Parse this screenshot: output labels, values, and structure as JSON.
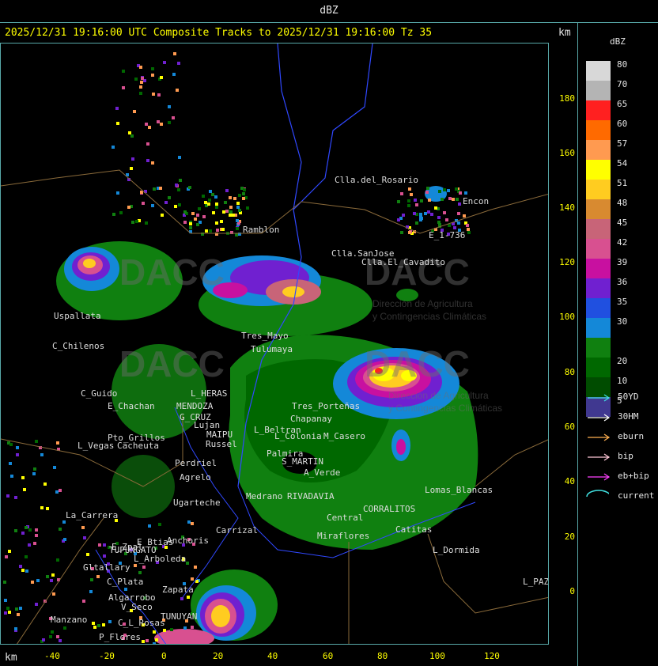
{
  "window": {
    "title": "dBZ"
  },
  "header": {
    "title": "2025/12/31 19:16:00 UTC Composite Tracks to 2025/12/31 19:16:00 Tz 35",
    "units_top": "km",
    "units_bottom": "km"
  },
  "legend": {
    "title": "dBZ",
    "scale": [
      {
        "label": "80",
        "color": "#d8d8d8"
      },
      {
        "label": "70",
        "color": "#b4b4b4"
      },
      {
        "label": "65",
        "color": "#ff2020"
      },
      {
        "label": "60",
        "color": "#ff6a00"
      },
      {
        "label": "57",
        "color": "#ff9a50"
      },
      {
        "label": "54",
        "color": "#ffff00"
      },
      {
        "label": "51",
        "color": "#ffcc20"
      },
      {
        "label": "48",
        "color": "#d88a30"
      },
      {
        "label": "45",
        "color": "#c86478"
      },
      {
        "label": "42",
        "color": "#d85090"
      },
      {
        "label": "39",
        "color": "#c810a0"
      },
      {
        "label": "36",
        "color": "#7020d0"
      },
      {
        "label": "35",
        "color": "#2050e0"
      },
      {
        "label": "30",
        "color": "#1488d8"
      },
      {
        "label": "",
        "color": "#108010"
      },
      {
        "label": "20",
        "color": "#006800"
      },
      {
        "label": "10",
        "color": "#004c00"
      },
      {
        "label": "5",
        "color": "#403890"
      }
    ],
    "tracks": [
      {
        "label": "50YD",
        "color": "#40e0e0"
      },
      {
        "label": "30HM",
        "color": "#ffffff"
      },
      {
        "label": "eburn",
        "color": "#ffb050"
      },
      {
        "label": "bip",
        "color": "#ffc8d8"
      },
      {
        "label": "eb+bip",
        "color": "#ff40ff"
      }
    ],
    "current": {
      "label": "current",
      "color": "#40e0e0"
    }
  },
  "axes": {
    "y_ticks": [
      "180",
      "160",
      "140",
      "120",
      "100",
      "80",
      "60",
      "40",
      "20",
      "0"
    ],
    "x_ticks": [
      "-40",
      "-20",
      "0",
      "20",
      "40",
      "60",
      "80",
      "100",
      "120"
    ]
  },
  "places": [
    {
      "name": "Clla.del_Rosario"
    },
    {
      "name": "Encon"
    },
    {
      "name": "E_1-736"
    },
    {
      "name": "Ramblon"
    },
    {
      "name": "Clla.SanJose"
    },
    {
      "name": "Clla.El_Cavadito"
    },
    {
      "name": "Uspallata"
    },
    {
      "name": "C_Chilenos"
    },
    {
      "name": "Tres_Mayo"
    },
    {
      "name": "Tulumaya"
    },
    {
      "name": "C_Guido"
    },
    {
      "name": "E_Chachan"
    },
    {
      "name": "MENDOZA"
    },
    {
      "name": "G_CRUZ"
    },
    {
      "name": "L_HERAS"
    },
    {
      "name": "Lujan"
    },
    {
      "name": "MAIPU"
    },
    {
      "name": "Russel"
    },
    {
      "name": "Pto_Grillos"
    },
    {
      "name": "L_Vegas"
    },
    {
      "name": "Cacheuta"
    },
    {
      "name": "Perdriel"
    },
    {
      "name": "Agrelo"
    },
    {
      "name": "S_MARTIN"
    },
    {
      "name": "L_Beltran"
    },
    {
      "name": "Chapanay"
    },
    {
      "name": "Palmira"
    },
    {
      "name": "L_Colonia"
    },
    {
      "name": "M_Casero"
    },
    {
      "name": "Tres_Porteñas"
    },
    {
      "name": "A_Verde"
    },
    {
      "name": "Ugarteche"
    },
    {
      "name": "La_Carrera"
    },
    {
      "name": "Carrizal"
    },
    {
      "name": "Anchoris"
    },
    {
      "name": "E_Zpal"
    },
    {
      "name": "L_Arboleda"
    },
    {
      "name": "TUPUNGATO"
    },
    {
      "name": "Gltallary"
    },
    {
      "name": "E_Btias"
    },
    {
      "name": "C_Plata"
    },
    {
      "name": "Zapata"
    },
    {
      "name": "Algarrobo"
    },
    {
      "name": "V_Seco"
    },
    {
      "name": "Manzano"
    },
    {
      "name": "C_L_Rosas"
    },
    {
      "name": "TUNUYAN"
    },
    {
      "name": "P_Flores"
    },
    {
      "name": "Miraflores"
    },
    {
      "name": "Central"
    },
    {
      "name": "Catitas"
    },
    {
      "name": "L_Dormida"
    },
    {
      "name": "L_PAZ"
    },
    {
      "name": "Lomas_Blancas"
    },
    {
      "name": "RIVADAVIA"
    },
    {
      "name": "Medrano"
    },
    {
      "name": "CORRALITOS"
    }
  ],
  "watermark": {
    "brand": "DACC",
    "subtitle_1": "Dirección de Agricultura",
    "subtitle_2": "y Contingencias Climáticas"
  }
}
